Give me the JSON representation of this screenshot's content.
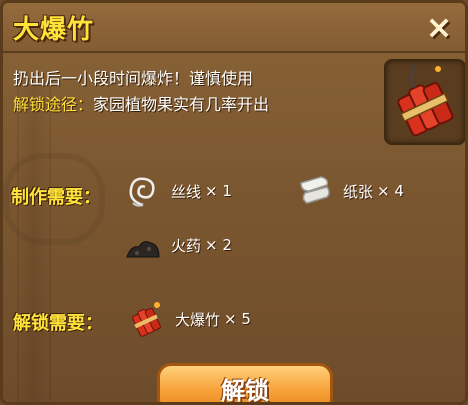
{
  "title": "大爆竹",
  "close_icon": "×",
  "description": "扔出后一小段时间爆炸！谨慎使用",
  "unlock_way": {
    "label": "解锁途径：",
    "text": "家园植物果实有几率开出"
  },
  "crafting": {
    "label": "制作需要：",
    "materials": [
      {
        "icon": "thread-icon",
        "name": "丝线",
        "qty": "× 1"
      },
      {
        "icon": "paper-icon",
        "name": "纸张",
        "qty": "× 4"
      },
      {
        "icon": "gunpowder-icon",
        "name": "火药",
        "qty": "× 2"
      }
    ]
  },
  "unlock_req": {
    "label": "解锁需要：",
    "item": {
      "icon": "firecracker-icon",
      "name": "大爆竹",
      "qty": "× 5"
    }
  },
  "unlock_button": "解锁",
  "colors": {
    "title": "#ffe23a",
    "panel": "#7a5630",
    "button": "#f7a23a"
  }
}
